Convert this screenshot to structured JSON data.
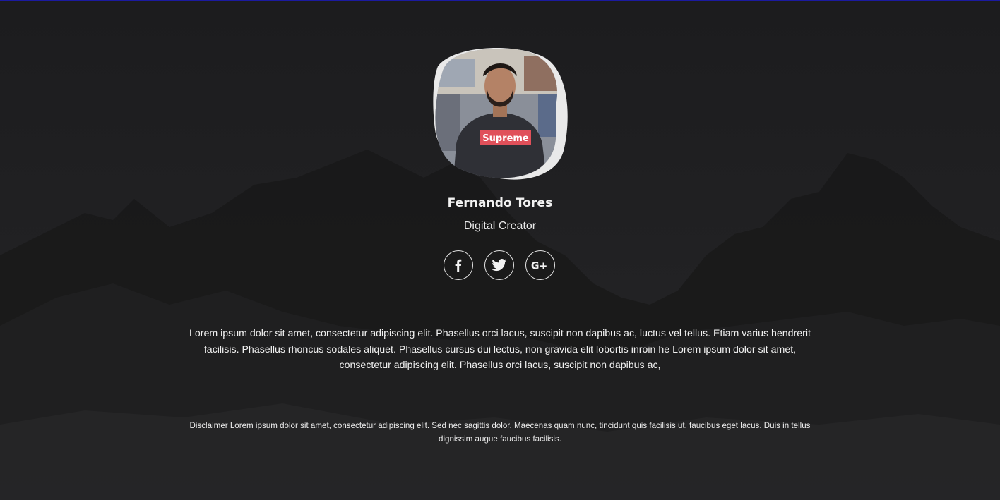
{
  "profile": {
    "name": "Fernando Tores",
    "role": "Digital Creator",
    "shirt_text": "Supreme"
  },
  "socials": [
    {
      "icon": "facebook-icon",
      "label": "f"
    },
    {
      "icon": "twitter-icon",
      "label": ""
    },
    {
      "icon": "google-plus-icon",
      "label": "G+"
    }
  ],
  "bio": "Lorem ipsum dolor sit amet, consectetur adipiscing elit. Phasellus orci lacus, suscipit non dapibus ac, luctus vel tellus. Etiam varius hendrerit facilisis. Phasellus rhoncus sodales aliquet. Phasellus cursus dui lectus, non gravida elit lobortis inroin he Lorem ipsum dolor sit amet, consectetur adipiscing elit. Phasellus orci lacus, suscipit non dapibus ac,",
  "disclaimer": "Disclaimer Lorem ipsum dolor sit amet, consectetur adipiscing elit. Sed nec sagittis dolor. Maecenas quam nunc, tincidunt quis facilisis ut, faucibus eget lacus. Duis in tellus dignissim augue faucibus facilisis.",
  "colors": {
    "background": "#1f1f21",
    "top_bar": "#1b1aa0",
    "text": "#f0f0f0",
    "badge": "#e0505a"
  }
}
